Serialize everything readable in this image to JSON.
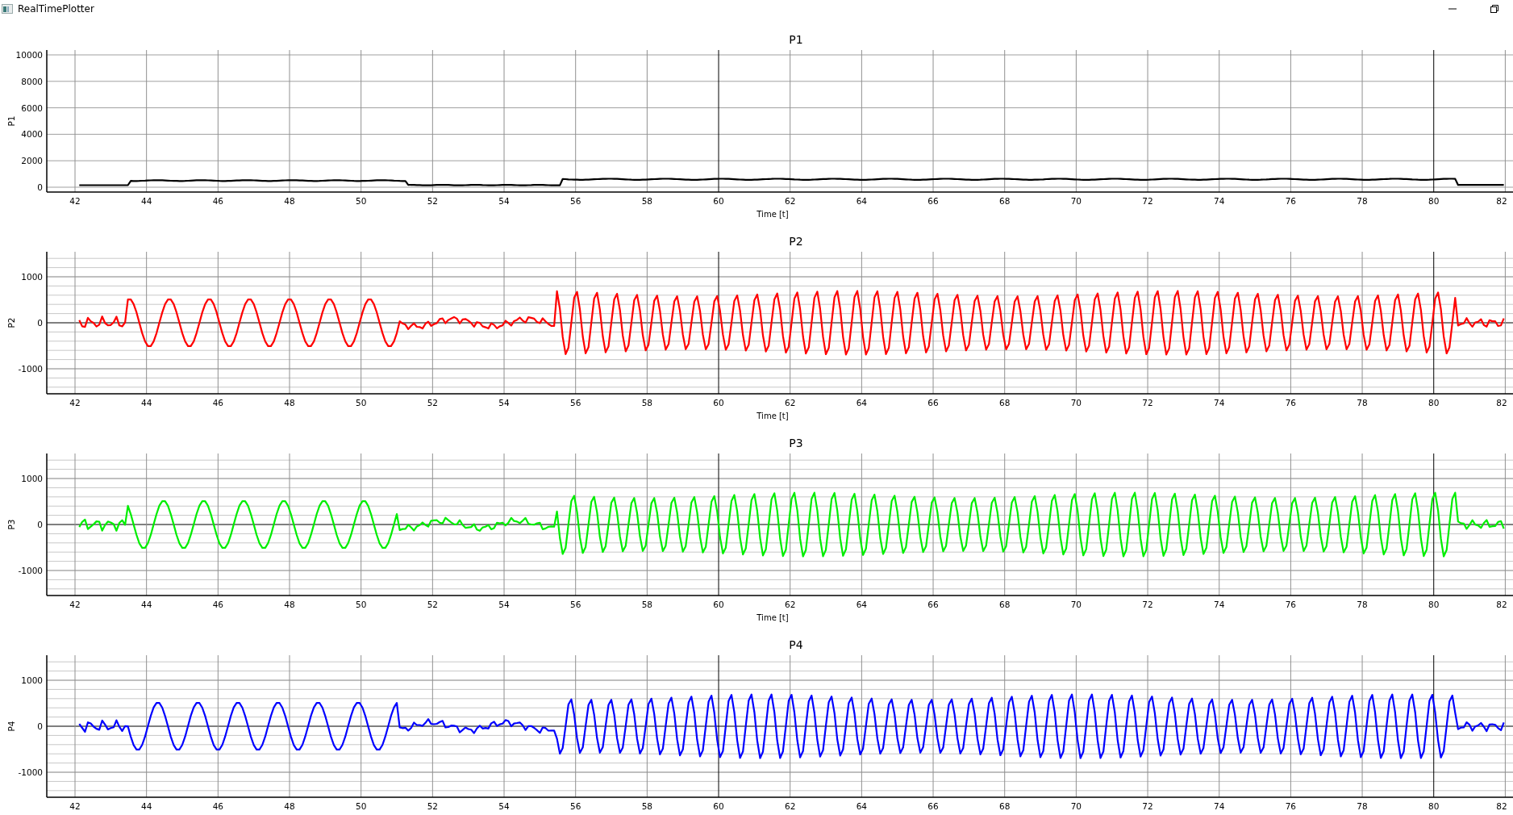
{
  "window": {
    "title": "RealTimePlotter"
  },
  "plots": [
    {
      "title": "P1",
      "ylabel": "P1",
      "kind": "level",
      "color": "#000000",
      "xlabel": "Time [t]",
      "yticks": [
        "10000",
        "8000",
        "6000",
        "4000",
        "2000",
        "0"
      ],
      "xticks": [
        "42",
        "44",
        "46",
        "48",
        "50",
        "52",
        "54",
        "56",
        "58",
        "60",
        "62",
        "64",
        "66",
        "68",
        "70",
        "72",
        "74",
        "76",
        "78",
        "80",
        "82"
      ]
    },
    {
      "title": "P2",
      "ylabel": "P2",
      "kind": "wave",
      "color": "#ff0000",
      "xlabel": "Time [t]",
      "yticks": [
        "1000",
        "0",
        "-1000"
      ],
      "xticks": [
        "42",
        "44",
        "46",
        "48",
        "50",
        "52",
        "54",
        "56",
        "58",
        "60",
        "62",
        "64",
        "66",
        "68",
        "70",
        "72",
        "74",
        "76",
        "78",
        "80",
        "82"
      ]
    },
    {
      "title": "P3",
      "ylabel": "P3",
      "kind": "wave",
      "color": "#00ee00",
      "xlabel": "Time [t]",
      "yticks": [
        "1000",
        "0",
        "-1000"
      ],
      "xticks": [
        "42",
        "44",
        "46",
        "48",
        "50",
        "52",
        "54",
        "56",
        "58",
        "60",
        "62",
        "64",
        "66",
        "68",
        "70",
        "72",
        "74",
        "76",
        "78",
        "80",
        "82"
      ]
    },
    {
      "title": "P4",
      "ylabel": "P4",
      "kind": "wave",
      "color": "#0000ff",
      "yticks": [
        "1000",
        "0",
        "-1000"
      ],
      "xticks": [
        "42",
        "44",
        "46",
        "48",
        "50",
        "52",
        "54",
        "56",
        "58",
        "60",
        "62",
        "64",
        "66",
        "68",
        "70",
        "72",
        "74",
        "76",
        "78",
        "80",
        "82"
      ]
    }
  ]
}
